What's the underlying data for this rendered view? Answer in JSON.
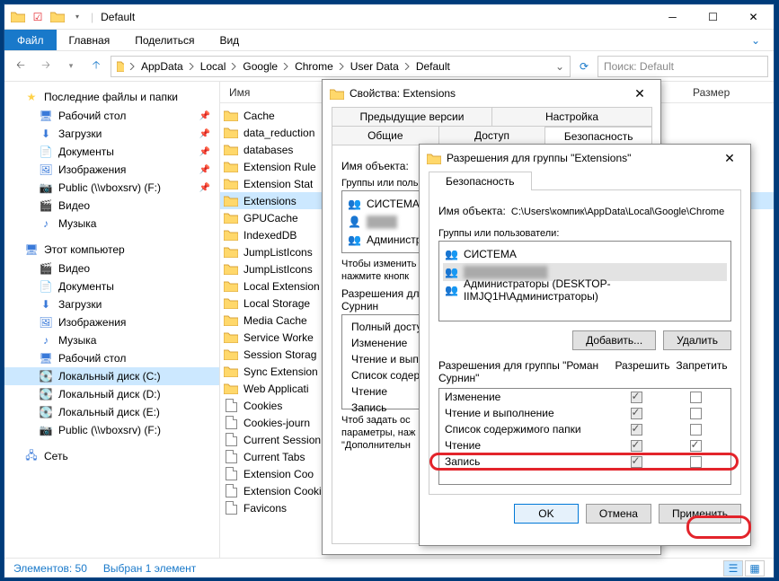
{
  "titlebar": {
    "title": "Default"
  },
  "ribbon": {
    "file": "Файл",
    "tabs": [
      "Главная",
      "Поделиться",
      "Вид"
    ]
  },
  "breadcrumbs": [
    "AppData",
    "Local",
    "Google",
    "Chrome",
    "User Data",
    "Default"
  ],
  "search": {
    "placeholder": "Поиск: Default"
  },
  "sidebar": {
    "quick": {
      "header": "Последние файлы и папки",
      "items": [
        {
          "label": "Рабочий стол",
          "pin": true
        },
        {
          "label": "Загрузки",
          "pin": true
        },
        {
          "label": "Документы",
          "pin": true
        },
        {
          "label": "Изображения",
          "pin": true
        },
        {
          "label": "Public (\\\\vboxsrv) (F:)",
          "pin": true
        },
        {
          "label": "Видео",
          "pin": false
        },
        {
          "label": "Музыка",
          "pin": false
        }
      ]
    },
    "pc": {
      "header": "Этот компьютер",
      "items": [
        {
          "label": "Видео"
        },
        {
          "label": "Документы"
        },
        {
          "label": "Загрузки"
        },
        {
          "label": "Изображения"
        },
        {
          "label": "Музыка"
        },
        {
          "label": "Рабочий стол"
        },
        {
          "label": "Локальный диск (C:)",
          "sel": true
        },
        {
          "label": "Локальный диск (D:)"
        },
        {
          "label": "Локальный диск (E:)"
        },
        {
          "label": "Public (\\\\vboxsrv) (F:)"
        }
      ]
    },
    "net": {
      "header": "Сеть"
    }
  },
  "columns": {
    "name": "Имя",
    "size": "Размер"
  },
  "files": [
    {
      "n": "Cache",
      "t": "folder"
    },
    {
      "n": "data_reduction",
      "t": "folder"
    },
    {
      "n": "databases",
      "t": "folder"
    },
    {
      "n": "Extension Rule",
      "t": "folder"
    },
    {
      "n": "Extension Stat",
      "t": "folder"
    },
    {
      "n": "Extensions",
      "t": "folder",
      "sel": true
    },
    {
      "n": "GPUCache",
      "t": "folder"
    },
    {
      "n": "IndexedDB",
      "t": "folder"
    },
    {
      "n": "JumpListIcons",
      "t": "folder"
    },
    {
      "n": "JumpListIcons",
      "t": "folder"
    },
    {
      "n": "Local Extension",
      "t": "folder"
    },
    {
      "n": "Local Storage",
      "t": "folder"
    },
    {
      "n": "Media Cache",
      "t": "folder"
    },
    {
      "n": "Service Worke",
      "t": "folder"
    },
    {
      "n": "Session Storag",
      "t": "folder"
    },
    {
      "n": "Sync Extension",
      "t": "folder"
    },
    {
      "n": "Web Applicati",
      "t": "folder"
    },
    {
      "n": "Cookies",
      "t": "file"
    },
    {
      "n": "Cookies-journ",
      "t": "file"
    },
    {
      "n": "Current Session",
      "t": "file"
    },
    {
      "n": "Current Tabs",
      "t": "file"
    },
    {
      "n": "Extension Coo",
      "t": "file"
    },
    {
      "n": "Extension Cookies-journal",
      "t": "file"
    },
    {
      "n": "Favicons",
      "t": "file"
    }
  ],
  "status": {
    "count": "Элементов: 50",
    "sel": "Выбран 1 элемент"
  },
  "dlg1": {
    "title": "Свойства: Extensions",
    "tabs_row1": [
      "Предыдущие версии",
      "Настройка"
    ],
    "tabs_row2": [
      "Общие",
      "Доступ",
      "Безопасность"
    ],
    "obj_label": "Имя объекта:",
    "groups_label": "Группы или поль",
    "users": [
      "СИСТЕМА",
      "",
      "Администрат"
    ],
    "hint1": "Чтобы изменить",
    "hint2": "нажмите кнопк",
    "perm_label": "Разрешения для",
    "perm_label2": "Сурнин",
    "perms": [
      "Полный досту",
      "Изменение",
      "Чтение и выпо",
      "Список содер",
      "Чтение",
      "Запись"
    ],
    "hint3": "Чтоб задать ос",
    "hint4": "параметры, наж",
    "hint5": "\"Дополнительн"
  },
  "dlg2": {
    "title": "Разрешения для группы \"Extensions\"",
    "tab": "Безопасность",
    "obj_label": "Имя объекта:",
    "obj_value": "C:\\Users\\компик\\AppData\\Local\\Google\\Chrome",
    "groups_label": "Группы или пользователи:",
    "users": [
      {
        "n": "СИСТЕМА"
      },
      {
        "n": "",
        "blur": true
      },
      {
        "n": "Администраторы (DESKTOP-IIMJQ1H\\Администраторы)"
      }
    ],
    "add": "Добавить...",
    "remove": "Удалить",
    "perm_for": "Разрешения для группы \"Роман Сурнин\"",
    "allow": "Разрешить",
    "deny": "Запретить",
    "perms": [
      {
        "n": "Изменение",
        "a": true,
        "d": false
      },
      {
        "n": "Чтение и выполнение",
        "a": true,
        "d": false
      },
      {
        "n": "Список содержимого папки",
        "a": true,
        "d": false
      },
      {
        "n": "Чтение",
        "a": true,
        "d": true
      },
      {
        "n": "Запись",
        "a": true,
        "d": false
      }
    ],
    "ok": "OK",
    "cancel": "Отмена",
    "apply": "Применить"
  }
}
